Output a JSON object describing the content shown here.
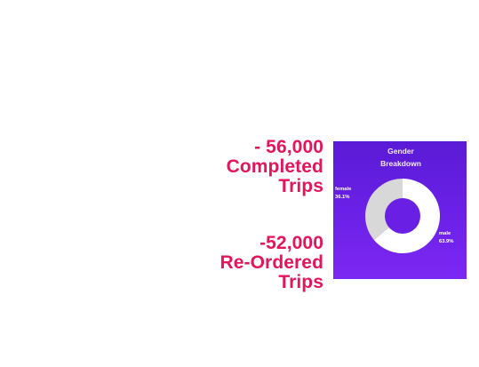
{
  "stats": {
    "completed": {
      "line1": "- 56,000",
      "line2": "Completed",
      "line3": "Trips"
    },
    "reordered": {
      "line1": "-52,000",
      "line2": "Re-Ordered",
      "line3": "Trips"
    }
  },
  "colors": {
    "stat_text": "#e3165b",
    "card_bg_top": "#5a1bd6",
    "card_bg_bottom": "#7c28f2",
    "female_slice": "#d8d8d8",
    "male_slice": "#ffffff",
    "donut_hole": "#6a20e4"
  },
  "chart_data": {
    "type": "pie",
    "title_line1": "Gender",
    "title_line2": "Breakdown",
    "donut": true,
    "slices": [
      {
        "label": "female",
        "value_label": "36.1%",
        "value": 36.1,
        "color": "#d8d8d8"
      },
      {
        "label": "male",
        "value_label": "63.9%",
        "value": 63.9,
        "color": "#ffffff"
      }
    ]
  }
}
